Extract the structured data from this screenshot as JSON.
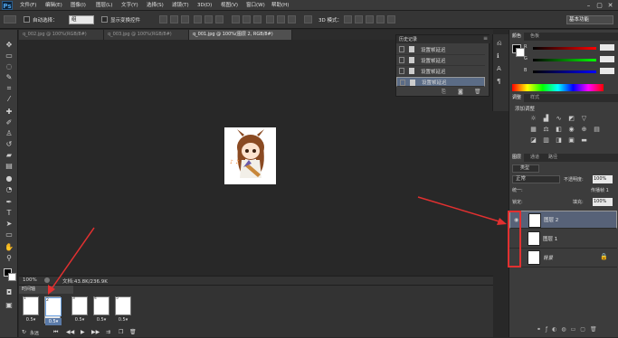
{
  "app": {
    "logo": "Ps"
  },
  "menu": [
    "文件(F)",
    "编辑(E)",
    "图像(I)",
    "图层(L)",
    "文字(Y)",
    "选择(S)",
    "滤镜(T)",
    "3D(D)",
    "视图(V)",
    "窗口(W)",
    "帮助(H)"
  ],
  "window_controls": {
    "minimize": "–",
    "restore": "▢",
    "close": "✕"
  },
  "options": {
    "auto_select_label": "自动选择：",
    "auto_select_value": "组",
    "transform_label": "显示变换控件",
    "mode_3d_label": "3D 模式：",
    "workspace": "基本功能"
  },
  "tabs": [
    {
      "label": "q_002.jpg @ 100%(RGB/8#)",
      "active": false
    },
    {
      "label": "q_003.jpg @ 100%(RGB/8#)",
      "active": false
    },
    {
      "label": "q_001.jpg @ 100%(图层 2, RGB/8#)",
      "active": true
    }
  ],
  "statusbar": {
    "zoom": "100%",
    "doc": "文档:43.8K/236.9K"
  },
  "timeline": {
    "title": "时间轴",
    "frames": [
      {
        "num": "1",
        "delay": "0.5▾",
        "selected": false
      },
      {
        "num": "2",
        "delay": "0.5▾",
        "selected": true
      },
      {
        "num": "3",
        "delay": "0.5▾",
        "selected": false
      },
      {
        "num": "4",
        "delay": "0.5▾",
        "selected": false
      },
      {
        "num": "5",
        "delay": "0.5▾",
        "selected": false
      }
    ],
    "loop": "永远"
  },
  "history": {
    "title": "历史记录",
    "rows": [
      {
        "label": "设置帧延迟",
        "selected": false
      },
      {
        "label": "设置帧延迟",
        "selected": false
      },
      {
        "label": "设置帧延迟",
        "selected": false
      },
      {
        "label": "设置帧延迟",
        "selected": true
      }
    ]
  },
  "color_panel": {
    "tab1": "颜色",
    "tab2": "色板",
    "channels": [
      "R",
      "G",
      "B"
    ]
  },
  "adjust_panel": {
    "tab1": "调整",
    "tab2": "样式",
    "add_label": "添加调整"
  },
  "layers_panel": {
    "tabs": [
      "图层",
      "通道",
      "路径"
    ],
    "filter": "类型",
    "blend": "正常",
    "opacity_label": "不透明度:",
    "opacity": "100%",
    "unify_label": "统一:",
    "propagate_label": "传播帧 1",
    "lock_label": "锁定:",
    "fill_label": "填充:",
    "fill": "100%",
    "layers": [
      {
        "name": "图层 2",
        "visible": true,
        "selected": true,
        "locked": false
      },
      {
        "name": "图层 1",
        "visible": false,
        "selected": false,
        "locked": false
      },
      {
        "name": "背景",
        "visible": false,
        "selected": false,
        "locked": true
      }
    ]
  },
  "colors": {
    "accent": "#5b6c86",
    "annotation": "#e23030"
  }
}
